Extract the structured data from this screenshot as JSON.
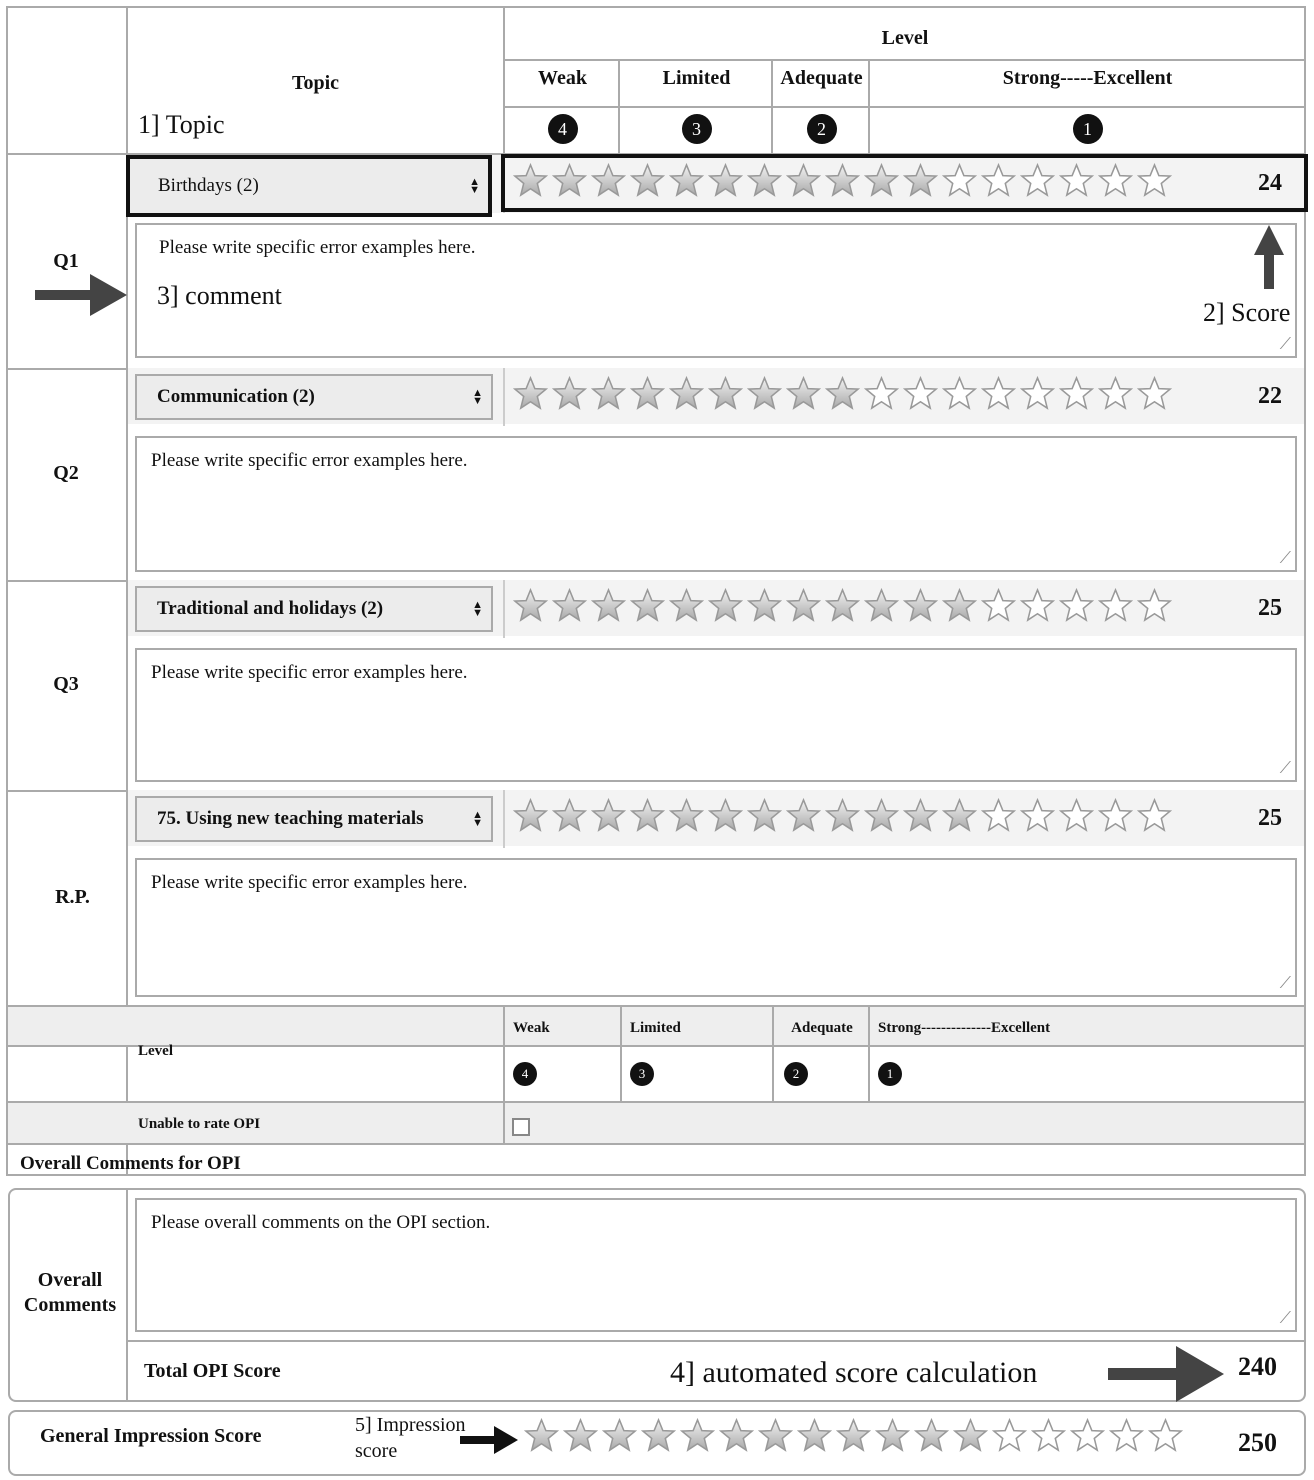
{
  "header": {
    "topic": "Topic",
    "level": "Level",
    "levels": [
      {
        "label": "Weak",
        "num": "4"
      },
      {
        "label": "Limited",
        "num": "3"
      },
      {
        "label": "Adequate",
        "num": "2"
      },
      {
        "label": "Strong-----Excellent",
        "num": "1"
      }
    ]
  },
  "annotations": {
    "topic": "1] Topic",
    "score": "2] Score",
    "comment": "3] comment",
    "auto": "4] automated score calculation",
    "impression": "5] Impression score"
  },
  "questions": [
    {
      "label": "Q1",
      "topic": "Birthdays (2)",
      "score": "24",
      "filled": 11,
      "comment": "Please write specific error examples here."
    },
    {
      "label": "Q2",
      "topic": "Communication (2)",
      "score": "22",
      "filled": 9,
      "comment": "Please write specific error examples here."
    },
    {
      "label": "Q3",
      "topic": "Traditional and holidays (2)",
      "score": "25",
      "filled": 12,
      "comment": "Please write specific error examples here."
    },
    {
      "label": "R.P.",
      "topic": "75. Using new teaching materials",
      "score": "25",
      "filled": 12,
      "comment": "Please write specific error examples here."
    }
  ],
  "total_stars": 17,
  "footer_level": {
    "label": "Level",
    "levels": [
      {
        "label": "Weak",
        "num": "4"
      },
      {
        "label": "Limited",
        "num": "3"
      },
      {
        "label": "Adequate",
        "num": "2"
      },
      {
        "label": "Strong--------------Excellent",
        "num": "1"
      }
    ],
    "unable": "Unable to rate OPI"
  },
  "overall": {
    "section_title": "Overall Comments for OPI",
    "label": "Overall Comments",
    "placeholder": "Please overall comments on the OPI section.",
    "total_label": "Total OPI Score",
    "total": "240"
  },
  "impression": {
    "label": "General Impression Score",
    "filled": 12,
    "score": "250"
  }
}
